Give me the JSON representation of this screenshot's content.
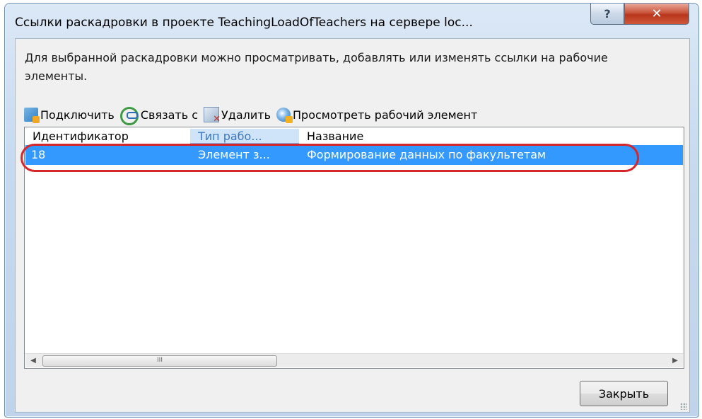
{
  "window": {
    "title": "Ссылки раскадровки в проекте TeachingLoadOfTeachers на сервере loc...",
    "help_label": "?",
    "close_label": "✕"
  },
  "description": "Для выбранной раскадровки можно просматривать, добавлять или изменять ссылки на рабочие элементы.",
  "toolbar": {
    "connect_label": "Подключить",
    "link_label": "Связать с",
    "delete_label": "Удалить",
    "view_label": "Просмотреть рабочий элемент"
  },
  "list": {
    "columns": [
      "Идентификатор",
      "Тип рабо...",
      "Название"
    ],
    "rows": [
      {
        "id": "18",
        "type": "Элемент з...",
        "name": "Формирование данных по факультетам"
      }
    ],
    "scroll_thumb_label": "III"
  },
  "footer": {
    "close_button_label": "Закрыть"
  },
  "colors": {
    "selection": "#3399ff",
    "annotation": "#d6262a"
  }
}
